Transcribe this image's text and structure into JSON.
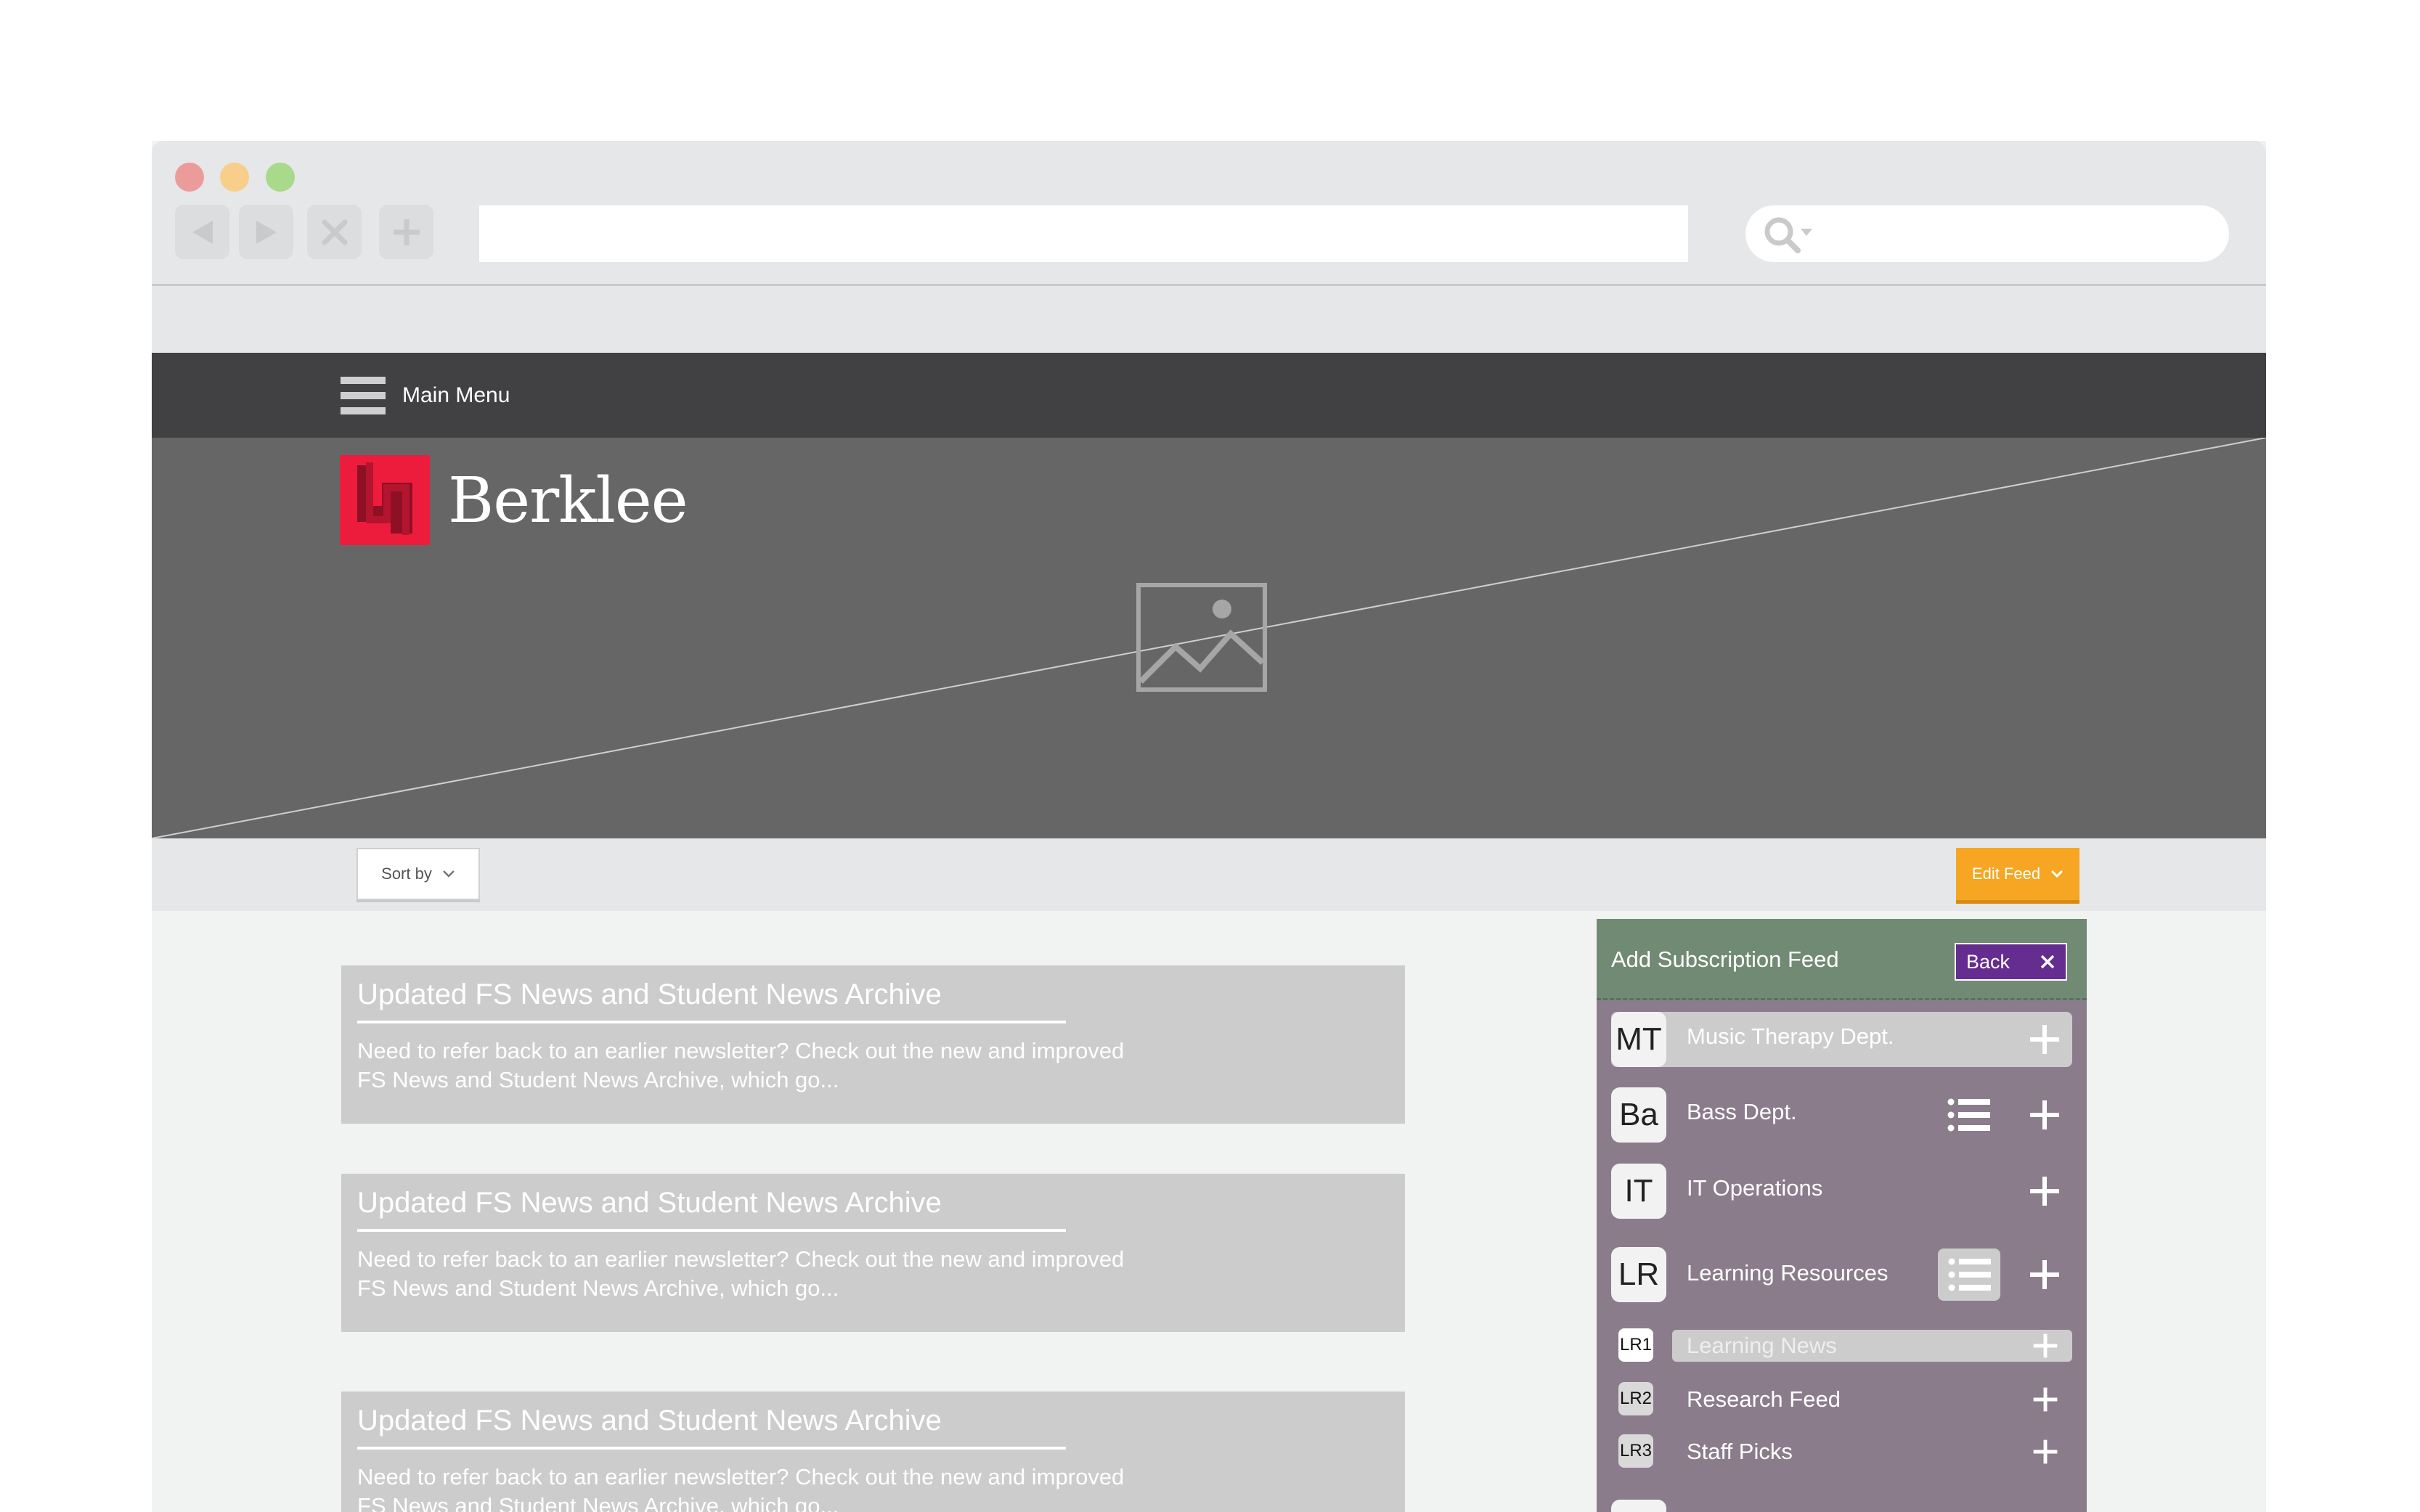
{
  "nav": {
    "menu_label": "Main Menu"
  },
  "brand": {
    "name": "Berklee",
    "accent": "#ee1c3c"
  },
  "toolbar": {
    "sort_label": "Sort by",
    "edit_label": "Edit Feed"
  },
  "cards": [
    {
      "title": "Updated FS News and Student News Archive",
      "body": "Need to refer back to an earlier newsletter? Check out the new and improved FS News and Student News Archive, which go..."
    },
    {
      "title": "Updated FS News and Student News Archive",
      "body": "Need to refer back to an earlier newsletter? Check out the new and improved FS News and Student News Archive, which go..."
    },
    {
      "title": "Updated FS News and Student News Archive",
      "body": "Need to refer back to an earlier newsletter? Check out the new and improved FS News and Student News Archive, which go..."
    }
  ],
  "panel": {
    "title": "Add Subscription Feed",
    "back_label": "Back",
    "feeds": [
      {
        "initials": "MT",
        "label": "Music Therapy Dept."
      },
      {
        "initials": "Ba",
        "label": "Bass Dept."
      },
      {
        "initials": "IT",
        "label": "IT Operations"
      },
      {
        "initials": "LR",
        "label": "Learning Resources"
      }
    ],
    "subfeeds": [
      {
        "initials": "LR1",
        "label": "Learning News"
      },
      {
        "initials": "LR2",
        "label": "Research Feed"
      },
      {
        "initials": "LR3",
        "label": "Staff Picks"
      }
    ]
  }
}
